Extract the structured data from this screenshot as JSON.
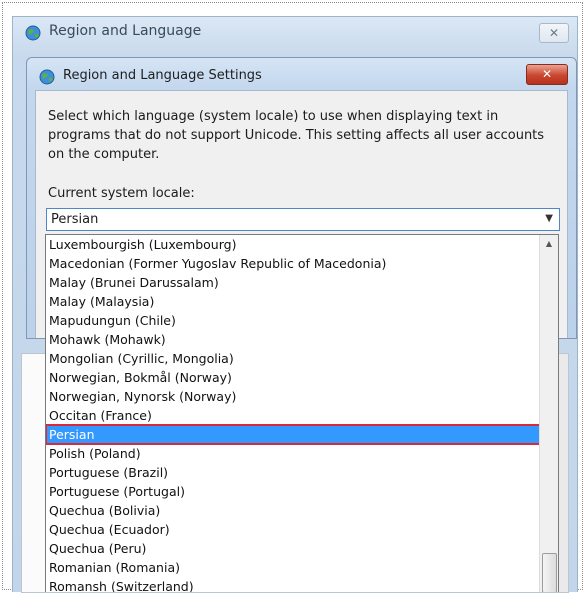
{
  "outer_window": {
    "title": "Region and Language",
    "close_label": "✕"
  },
  "dialog": {
    "title": "Region and Language Settings",
    "close_label": "✕",
    "description": "Select which language (system locale) to use when displaying text in programs that do not support Unicode. This setting affects all user accounts on the computer.",
    "locale_label": "Current system locale:",
    "selected_locale": "Persian"
  },
  "dropdown": {
    "items": [
      "Luxembourgish (Luxembourg)",
      "Macedonian (Former Yugoslav Republic of Macedonia)",
      "Malay (Brunei Darussalam)",
      "Malay (Malaysia)",
      "Mapudungun (Chile)",
      "Mohawk (Mohawk)",
      "Mongolian (Cyrillic, Mongolia)",
      "Norwegian, Bokmål (Norway)",
      "Norwegian, Nynorsk (Norway)",
      "Occitan (France)",
      "Persian",
      "Polish (Poland)",
      "Portuguese (Brazil)",
      "Portuguese (Portugal)",
      "Quechua (Bolivia)",
      "Quechua (Ecuador)",
      "Quechua (Peru)",
      "Romanian (Romania)",
      "Romansh (Switzerland)"
    ],
    "selected_index": 10
  },
  "icons": {
    "window_icon": "globe-icon",
    "dropdown_arrow": "chevron-down-icon",
    "scroll_up": "scroll-up-arrow-icon"
  },
  "colors": {
    "selection": "#3399ff",
    "selection_outline": "#d8283a",
    "close_button": "#c9462f"
  }
}
